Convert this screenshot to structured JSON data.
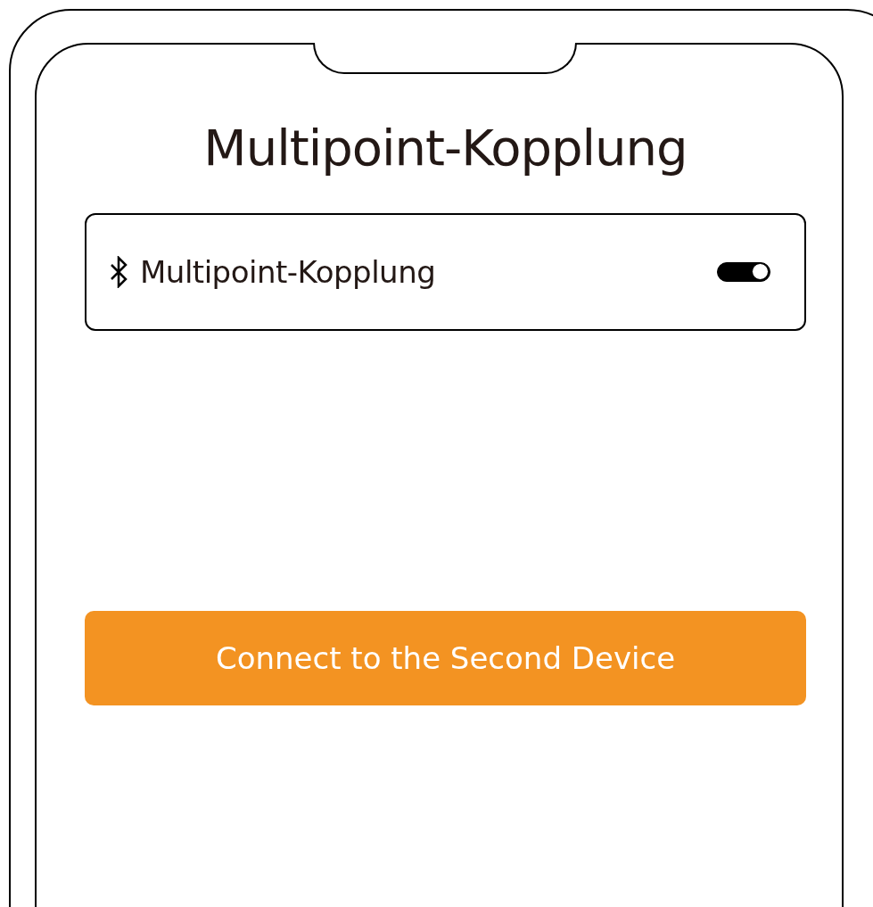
{
  "title": "Multipoint-Kopplung",
  "setting": {
    "label": "Multipoint-Kopplung",
    "on": true
  },
  "button": {
    "label": "Connect to the Second Device"
  }
}
